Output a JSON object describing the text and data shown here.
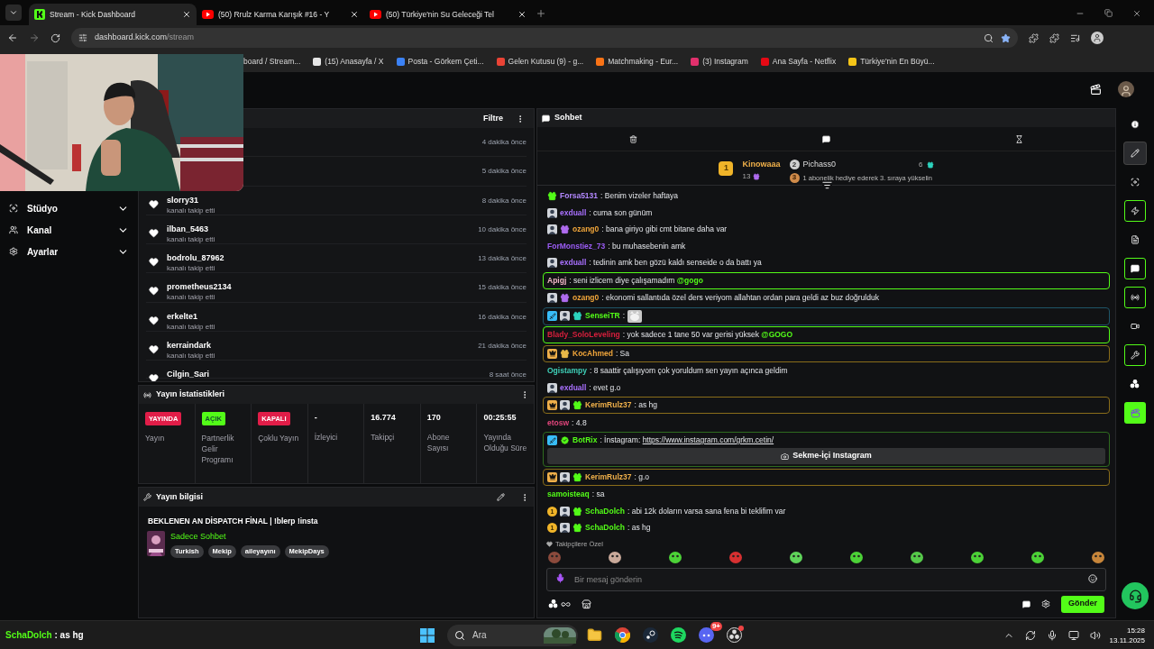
{
  "browser": {
    "tabs": [
      {
        "title": "Stream - Kick Dashboard",
        "kind": "kick",
        "selected": true
      },
      {
        "title": "(50) Rrulz Karma Karışık #16 - Y",
        "kind": "youtube",
        "selected": false
      },
      {
        "title": "(50) Türkiye'nin Su Geleceği Tel",
        "kind": "youtube",
        "selected": false
      }
    ],
    "url_host": "dashboard.kick.com",
    "url_path": "/stream",
    "bookmarks": [
      {
        "title": "board / Stream..."
      },
      {
        "title": "(15) Anasayfa / X",
        "color": "#e5e5e5"
      },
      {
        "title": "Posta - Görkem Çeti...",
        "color": "#3b82f6"
      },
      {
        "title": "Gelen Kutusu (9) - g...",
        "color": "#ea4335"
      },
      {
        "title": "Matchmaking - Eur...",
        "color": "#f97316"
      },
      {
        "title": "(3) Instagram",
        "color": "#e1306c"
      },
      {
        "title": "Ana Sayfa - Netflix",
        "color": "#e50914"
      },
      {
        "title": "Türkiye'nin En Büyü...",
        "color": "#f5c518"
      }
    ]
  },
  "sidebar": {
    "items": [
      {
        "label": "Stüdyo",
        "expanded": false
      },
      {
        "label": "Kanal",
        "expanded": false
      },
      {
        "label": "Ayarlar",
        "expanded": false
      }
    ]
  },
  "activity": {
    "filter": "Filtre",
    "rows": [
      {
        "time": "4 dakika önce"
      },
      {
        "time": "5 dakika önce"
      },
      {
        "name": "slorry31",
        "action": "kanalı takip etti",
        "time": "8 dakika önce"
      },
      {
        "name": "ilban_5463",
        "action": "kanalı takip etti",
        "time": "10 dakika önce"
      },
      {
        "name": "bodrolu_87962",
        "action": "kanalı takip etti",
        "time": "13 dakika önce"
      },
      {
        "name": "prometheus2134",
        "action": "kanalı takip etti",
        "time": "15 dakika önce"
      },
      {
        "name": "erkelte1",
        "action": "kanalı takip etti",
        "time": "16 dakika önce"
      },
      {
        "name": "kerraindark",
        "action": "kanalı takip etti",
        "time": "21 dakika önce"
      },
      {
        "name": "Cilgin_Sari",
        "time": "8 saat önce"
      }
    ]
  },
  "stats": {
    "title": "Yayın İstatistikleri",
    "items": [
      {
        "kind": "badge",
        "badge": "YAYINDA",
        "color": "#e11d48",
        "label": "Yayın"
      },
      {
        "kind": "badge",
        "badge": "AÇIK",
        "color": "#53fc18",
        "label": "Partnerlik Gelir Programı"
      },
      {
        "kind": "badge",
        "badge": "KAPALI",
        "color": "#e11d48",
        "label": "Çoklu Yayın"
      },
      {
        "kind": "value",
        "value": "-",
        "label": "İzleyici"
      },
      {
        "kind": "value",
        "value": "16.774",
        "label": "Takipçi"
      },
      {
        "kind": "value",
        "value": "170",
        "label": "Abone Sayısı"
      },
      {
        "kind": "value",
        "value": "00:25:55",
        "label": "Yayında Olduğu Süre"
      }
    ]
  },
  "info": {
    "title": "Yayın bilgisi",
    "stream_title": "BEKLENEN AN DİSPATCH FİNAL | !blerp !insta",
    "category": "Sadece Sohbet",
    "tags": [
      "Turkish",
      "Mekip",
      "aileyayını",
      "MekipDays"
    ]
  },
  "chat": {
    "title": "Sohbet",
    "leaderboard": {
      "first": {
        "rank": "1",
        "name": "Kinowaaa",
        "count": "13"
      },
      "second": {
        "rank": "2",
        "name": "Pichass0",
        "count": "6"
      },
      "hint": {
        "rank": "3",
        "text": "1 abonelik hediye ederek 3. sıraya yükselin"
      }
    },
    "messages": [
      {
        "kind": "text",
        "author": {
          "name": "Forsa5131",
          "color": "#b388ff"
        },
        "text": ": Benim vizeler haftaya",
        "badges": [
          {
            "kind": "gift",
            "color": "#53fc18"
          }
        ]
      },
      {
        "kind": "text",
        "author": {
          "name": "exduall",
          "color": "#a970ff"
        },
        "text": ": cuma son günüm",
        "badges": [
          {
            "kind": "avatar"
          }
        ]
      },
      {
        "kind": "text",
        "author": {
          "name": "ozang0",
          "color": "#f0a53a"
        },
        "text": ": bana giriyo gibi cmt bitane daha var",
        "badges": [
          {
            "kind": "avatar"
          },
          {
            "kind": "gift",
            "color": "#b06cf0"
          }
        ]
      },
      {
        "kind": "text",
        "author": {
          "name": "ForMonstiez_73",
          "color": "#9b5cf6"
        },
        "text": ": bu muhasebenin amk"
      },
      {
        "kind": "text",
        "author": {
          "name": "exduall",
          "color": "#a970ff"
        },
        "text": ": tedinin amk ben gözü kaldı senseide o da battı ya",
        "badges": [
          {
            "kind": "avatar"
          }
        ]
      },
      {
        "kind": "text",
        "author": {
          "name": "Apigj",
          "color": "#f3b8c8"
        },
        "text": ": seni izlicem diye çalışamadım ",
        "mention": "@gogo",
        "highlight": {
          "color": "#53fc18"
        }
      },
      {
        "kind": "text",
        "author": {
          "name": "ozang0",
          "color": "#f0a53a"
        },
        "text": ": ekonomi sallantıda özel ders veriyom allahtan ordan para geldi az buz doğrulduk",
        "badges": [
          {
            "kind": "avatar"
          },
          {
            "kind": "gift",
            "color": "#b06cf0"
          }
        ]
      },
      {
        "kind": "emote",
        "author": {
          "name": "SenseiTR",
          "color": "#53fc18"
        },
        "text": ":",
        "highlight": {
          "color": "#1f5568"
        },
        "badges": [
          {
            "kind": "mod"
          },
          {
            "kind": "avatar"
          },
          {
            "kind": "gift",
            "color": "#2dd4bf"
          }
        ]
      },
      {
        "kind": "text",
        "author": {
          "name": "Blady_SoloLeveling",
          "color": "#d61f3c"
        },
        "text": ": yok sadece 1 tane 50 var gerisi yüksek ",
        "mention": "@GOGO",
        "highlight": {
          "color": "#53fc18"
        }
      },
      {
        "kind": "text",
        "author": {
          "name": "KocAhmed",
          "color": "#f0a53a"
        },
        "text": ": Sa",
        "highlight": {
          "color": "#8a6d1a"
        },
        "badges": [
          {
            "kind": "crown"
          },
          {
            "kind": "gift",
            "color": "#e9b949"
          }
        ]
      },
      {
        "kind": "text",
        "author": {
          "name": "Ogistampy",
          "color": "#3fd0b8"
        },
        "text": ": 8 saattir çalışıyom çok yoruldum sen yayın açınca geldim"
      },
      {
        "kind": "text",
        "author": {
          "name": "exduall",
          "color": "#a970ff"
        },
        "text": ": evet g.o",
        "badges": [
          {
            "kind": "avatar"
          }
        ]
      },
      {
        "kind": "text",
        "author": {
          "name": "KerimRulz37",
          "color": "#f0b04a"
        },
        "text": ": as hg",
        "highlight": {
          "color": "#8a6d1a"
        },
        "badges": [
          {
            "kind": "crown"
          },
          {
            "kind": "avatar"
          },
          {
            "kind": "gift",
            "color": "#53fc18"
          }
        ]
      },
      {
        "kind": "text",
        "author": {
          "name": "etosw",
          "color": "#e0457b"
        },
        "text": ": 4.8"
      },
      {
        "kind": "bot",
        "author": {
          "name": "BotRix",
          "color": "#53fc18"
        },
        "text": ": İnstagram: ",
        "link": "https://www.instagram.com/grkm.cetin/",
        "button": "Sekme-İçi Instagram",
        "highlight": {
          "color": "#2f6b1f"
        },
        "badges": [
          {
            "kind": "mod"
          },
          {
            "kind": "verified"
          }
        ]
      },
      {
        "kind": "text",
        "author": {
          "name": "KerimRulz37",
          "color": "#f0b04a"
        },
        "text": ": g.o",
        "highlight": {
          "color": "#8a6d1a"
        },
        "badges": [
          {
            "kind": "crown"
          },
          {
            "kind": "avatar"
          },
          {
            "kind": "gift",
            "color": "#53fc18"
          }
        ]
      },
      {
        "kind": "text",
        "author": {
          "name": "samoisteaq",
          "color": "#53fc18"
        },
        "text": ": sa"
      },
      {
        "kind": "text",
        "author": {
          "name": "SchaDolch",
          "color": "#53fc18"
        },
        "text": ": abi 12k doların varsa sana fena bi teklifim var",
        "badges": [
          {
            "kind": "rank",
            "label": "1"
          },
          {
            "kind": "avatar"
          },
          {
            "kind": "gift",
            "color": "#53fc18"
          }
        ]
      },
      {
        "kind": "text",
        "author": {
          "name": "SchaDolch",
          "color": "#53fc18"
        },
        "text": ": as hg",
        "badges": [
          {
            "kind": "rank",
            "label": "1"
          },
          {
            "kind": "avatar"
          },
          {
            "kind": "gift",
            "color": "#53fc18"
          }
        ]
      }
    ],
    "emotes_title": "Takipçilere Özel",
    "emotes": [
      {
        "color": "#8b4a3c"
      },
      {
        "color": "#c9a99a"
      },
      {
        "color": "#4cd137"
      },
      {
        "color": "#d63031"
      },
      {
        "color": "#5fd35a"
      },
      {
        "color": "#4cd137"
      },
      {
        "color": "#56c94a"
      },
      {
        "color": "#4cd137"
      },
      {
        "color": "#4cd137"
      },
      {
        "color": "#c7853a"
      }
    ],
    "input_placeholder": "Bir mesaj gönderin",
    "send": "Gönder"
  },
  "rail": [
    {
      "kind": "info",
      "selected": false,
      "outlined": false
    },
    {
      "kind": "edit",
      "selected": true,
      "outlined": false
    },
    {
      "kind": "capture",
      "selected": false,
      "outlined": false
    },
    {
      "kind": "lightning",
      "selected": false,
      "outlined": true
    },
    {
      "kind": "notes",
      "selected": false,
      "outlined": false
    },
    {
      "kind": "chat",
      "selected": false,
      "outlined": true
    },
    {
      "kind": "broadcast",
      "selected": false,
      "outlined": true
    },
    {
      "kind": "camera",
      "selected": false,
      "outlined": false
    },
    {
      "kind": "wrench",
      "selected": false,
      "outlined": true
    },
    {
      "kind": "dots",
      "selected": false,
      "outlined": false
    },
    {
      "kind": "app",
      "selected": false,
      "outlined": false
    }
  ],
  "taskbar": {
    "overlay_user": "SchaDolch",
    "overlay_text": " : as hg",
    "search": "Ara",
    "discord_badge": "9+",
    "time": "15:28",
    "date": "13.11.2025"
  }
}
